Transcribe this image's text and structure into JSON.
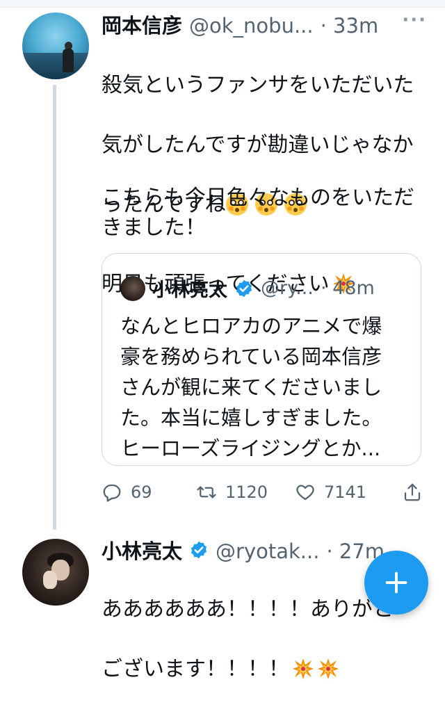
{
  "tweet1": {
    "display_name": "岡本信彦",
    "handle": "@ok_nobu...",
    "time": "· 33m",
    "more": "···",
    "line1": "殺気というファンサをいただいた",
    "line2": "気がしたんですが勘違いじゃなか",
    "line3": "ったんですね",
    "para2": "こちらも今日色々なものをいただ\nきました！\n明日も頑張ってください",
    "emoji_flushed_count": 3,
    "quote": {
      "display_name": "小林亮太",
      "handle": "@ry...",
      "time": "· 48m",
      "text": "なんとヒロアカのアニメで爆\n豪を務められている岡本信彦\nさんが観に来てくださいまし\nた。本当に嬉しすぎました。\nヒーローズライジングとか..."
    },
    "actions": {
      "replies": "69",
      "retweets": "1120",
      "likes": "7141"
    }
  },
  "tweet2": {
    "display_name": "小林亮太",
    "handle": "@ryotak...",
    "time": "· 27m",
    "line1": "ああああああ！！！！ありがと",
    "line2": "ございます！！！！"
  },
  "icons": {
    "verified": "verified-badge-icon",
    "reply": "reply-icon",
    "retweet": "retweet-icon",
    "like": "heart-icon",
    "share": "share-icon",
    "compose": "plus-icon"
  },
  "colors": {
    "accent": "#1d9bf0",
    "text": "#0f1419",
    "secondary": "#536471",
    "border": "#cfd9de"
  }
}
